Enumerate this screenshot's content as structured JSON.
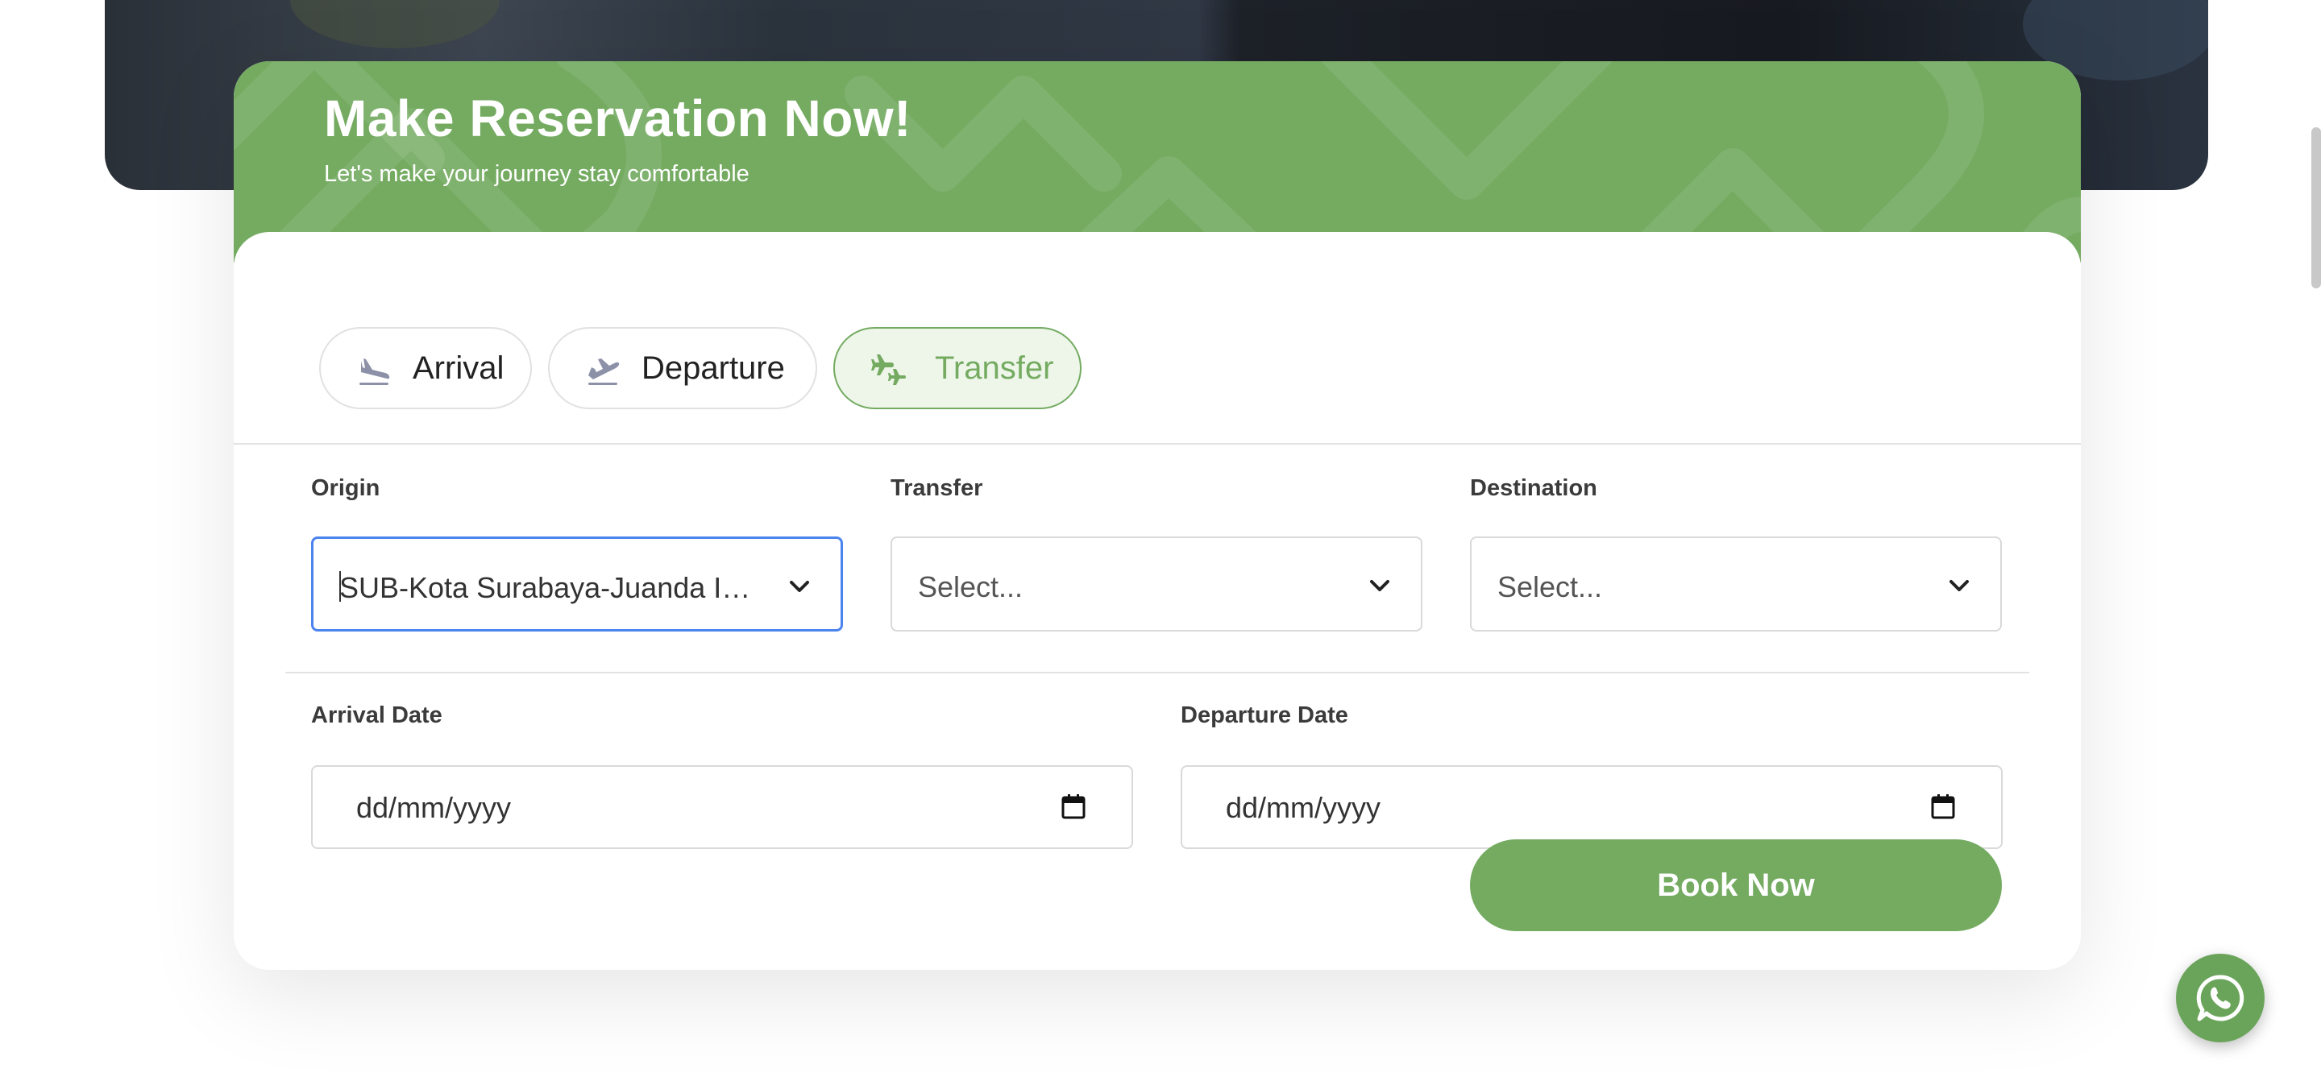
{
  "banner": {
    "title": "Make Reservation Now!",
    "subtitle": "Let's make your journey stay comfortable"
  },
  "tabs": [
    {
      "label": "Arrival",
      "icon": "plane-landing-icon",
      "active": false
    },
    {
      "label": "Departure",
      "icon": "plane-takeoff-icon",
      "active": false
    },
    {
      "label": "Transfer",
      "icon": "transfer-icon",
      "active": true
    }
  ],
  "form": {
    "origin": {
      "label": "Origin",
      "value": "SUB-Kota Surabaya-Juanda International Airport"
    },
    "transfer": {
      "label": "Transfer",
      "placeholder": "Select..."
    },
    "destination": {
      "label": "Destination",
      "placeholder": "Select..."
    },
    "arrival_date": {
      "label": "Arrival Date",
      "placeholder": "dd/mm/yyyy"
    },
    "departure_date": {
      "label": "Departure Date",
      "placeholder": "dd/mm/yyyy"
    },
    "submit_label": "Book Now"
  },
  "colors": {
    "brand_green": "#74ab61",
    "focus_blue": "#4c84ee"
  },
  "floating": {
    "icon": "whatsapp-icon"
  }
}
